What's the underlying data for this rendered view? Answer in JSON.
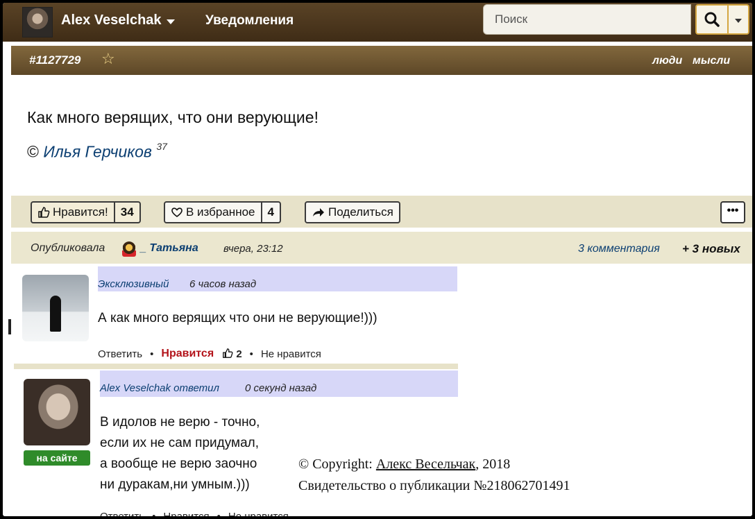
{
  "topbar": {
    "username": "Alex Veselchak",
    "notifications": "Уведомления",
    "search_placeholder": "Поиск"
  },
  "post": {
    "id": "#1127729",
    "tags": [
      "люди",
      "мысли"
    ],
    "text": "Как много верящих, что они верующие!",
    "copyright_symbol": "©",
    "author": "Илья Герчиков",
    "author_count": "37"
  },
  "actions": {
    "like_label": "Нравится!",
    "like_count": "34",
    "fav_label": "В избранное",
    "fav_count": "4",
    "share_label": "Поделиться",
    "more_label": "•••"
  },
  "meta": {
    "published_label": "Опубликовала",
    "publisher": "_ Татьяна",
    "time": "вчера, 23:12",
    "comments": "3 комментария",
    "new_comments": "+ 3 новых"
  },
  "comments": [
    {
      "user": "Эксклюзивный",
      "time": "6 часов назад",
      "text": "А как много верящих что они не верующие!)))",
      "reply": "Ответить",
      "like": "Нравится",
      "votes": "2",
      "dislike": "Не нравится"
    },
    {
      "user": "Alex Veselchak ответил",
      "time": "0 секунд назад",
      "lines": [
        "В идолов не верю - точно,",
        "если их не сам придумал,",
        "а вообще не верю заочно",
        "ни дуракам,ни умным.)))"
      ],
      "online": "на сайте",
      "reply": "Ответить",
      "like": "Нравится",
      "dislike": "Не нравится"
    }
  ],
  "copyright": {
    "prefix": "© Copyright: ",
    "author": "Алекс Весельчак",
    "year": ", 2018",
    "certificate": "Свидетельство о публикации №218062701491"
  },
  "colors": {
    "topbar": "#4b361d",
    "post_header": "#73592f",
    "action_bar": "#e7e2c9",
    "link": "#0c3f72",
    "liked": "#b3131a",
    "online": "#2f8b2a",
    "comment_head": "#d7d7f8"
  }
}
